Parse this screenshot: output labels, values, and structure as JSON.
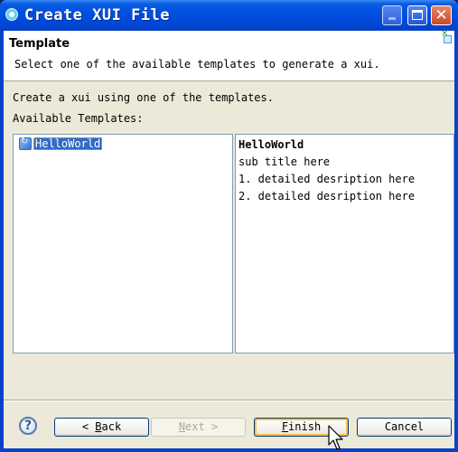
{
  "window": {
    "title": "Create XUI File",
    "controls": {
      "minimize": "minimize",
      "maximize": "maximize",
      "close": "✕"
    }
  },
  "header": {
    "title": "Template",
    "description": "Select one of the available templates to generate a xui."
  },
  "body": {
    "intro": "Create a xui using one of the templates.",
    "available_label": "Available Templates:",
    "templates": [
      {
        "label": "HelloWorld",
        "selected": true,
        "icon": "template-icon"
      }
    ],
    "description": {
      "title": "HelloWorld",
      "lines": [
        "sub title here",
        "1. detailed desription here",
        "2. detailed desription here"
      ]
    }
  },
  "footer": {
    "help": "?",
    "back": {
      "prefix": "< ",
      "mnemonic": "B",
      "rest": "ack",
      "enabled": true
    },
    "next": {
      "mnemonic": "N",
      "rest": "ext",
      "suffix": " >",
      "enabled": false
    },
    "finish": {
      "mnemonic": "F",
      "rest": "inish",
      "enabled": true,
      "default": true
    },
    "cancel": {
      "label": "Cancel",
      "enabled": true
    }
  }
}
